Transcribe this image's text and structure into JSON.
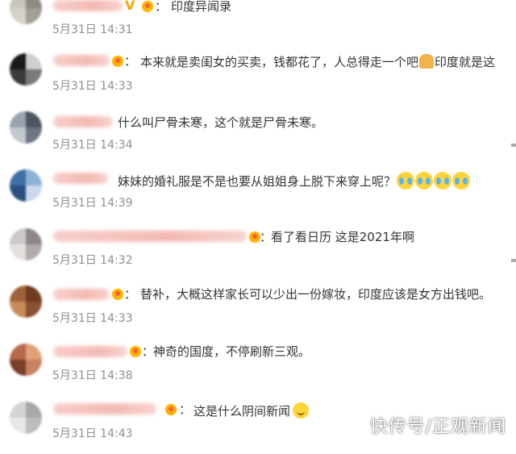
{
  "comments": [
    {
      "avatar_colors": [
        "#c9c4bd",
        "#8f8a84",
        "#d6d1cb",
        "#a39e97"
      ],
      "text": "印度异闻录",
      "time": "5月31日 14:31",
      "badge": "v"
    },
    {
      "avatar_colors": [
        "#1a1a1a",
        "#cfcfcf",
        "#3a3a3a",
        "#7a7a7a"
      ],
      "text_a": "本来就是卖闺女的买卖，钱都花了，人总得走一个吧",
      "text_b": "印度就是这",
      "time": "5月31日 14:33",
      "badge": "crown"
    },
    {
      "avatar_colors": [
        "#9aa3ad",
        "#4d5660",
        "#c2c8ce",
        "#6d7782"
      ],
      "text": "什么叫尸骨未寒，这个就是尸骨未寒。",
      "time": "5月31日 14:34",
      "badge": "none"
    },
    {
      "avatar_colors": [
        "#3f6fa6",
        "#8db2d8",
        "#28507f",
        "#c8d8ea"
      ],
      "text": "妹妹的婚礼服是不是也要从姐姐身上脱下来穿上呢？",
      "time": "5月31日 14:39",
      "badge": "none"
    },
    {
      "avatar_colors": [
        "#cfc9c9",
        "#8f8787",
        "#e5e0e0",
        "#b3aaaa"
      ],
      "text": "看了看日历 这是2021年啊",
      "time": "5月31日 14:32",
      "badge": "crown"
    },
    {
      "avatar_colors": [
        "#a0623a",
        "#6e3b1f",
        "#c98a5a",
        "#8a5031"
      ],
      "text": "替补，大概这样家长可以少出一份嫁妆，印度应该是女方出钱吧。",
      "time": "5月31日 14:33",
      "badge": "crown"
    },
    {
      "avatar_colors": [
        "#b86a4a",
        "#e0a07a",
        "#7a3f28",
        "#c98262"
      ],
      "text": "神奇的国度，不停刷新三观。",
      "time": "5月31日 14:38",
      "badge": "crown"
    },
    {
      "avatar_colors": [
        "#d4d4d4",
        "#a8a8a8",
        "#e8e8e8",
        "#bdbdbd"
      ],
      "text": "这是什么阴间新闻",
      "time": "5月31日 14:43",
      "badge": "crown"
    }
  ],
  "watermark": "快传号/正观新闻"
}
